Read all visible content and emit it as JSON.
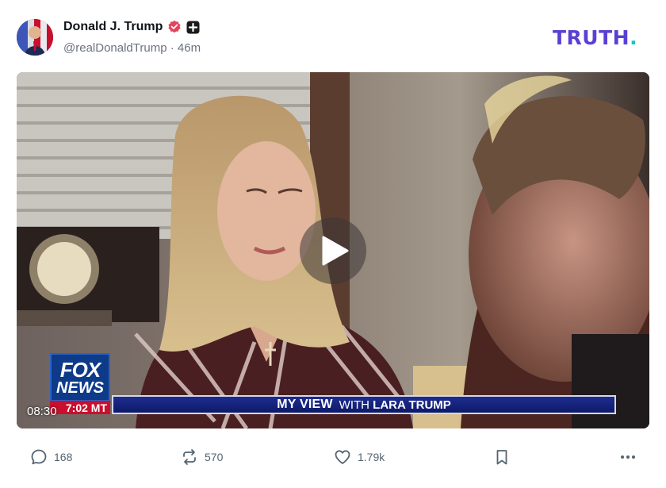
{
  "post": {
    "author": {
      "display_name": "Donald J. Trump",
      "handle": "@realDonaldTrump",
      "time": "· 46m"
    },
    "logo": {
      "text": "TRUTH",
      "dot": "."
    },
    "video": {
      "duration": "08:30",
      "overlay": {
        "network_top": "FOX",
        "network_bottom": "NEWS",
        "clock": "7:02 MT",
        "banner_title": "MY VIEW",
        "banner_with": "WITH",
        "banner_host": "LARA TRUMP"
      }
    },
    "actions": {
      "replies": "168",
      "retruths": "570",
      "likes": "1.79k"
    }
  },
  "colors": {
    "brand_purple": "#5a3fd6",
    "brand_teal": "#18c7b5",
    "verified": "#e2445c",
    "fox_blue": "#0e3a8a",
    "fox_red": "#c8102e",
    "icon_gray": "#536471"
  },
  "icons": {
    "reply": "speech-bubble-icon",
    "retruth": "retruth-arrows-icon",
    "like": "heart-icon",
    "bookmark": "bookmark-icon",
    "more": "more-dots-icon",
    "play": "play-icon",
    "verified": "verified-badge-icon",
    "plus": "plus-badge-icon"
  }
}
